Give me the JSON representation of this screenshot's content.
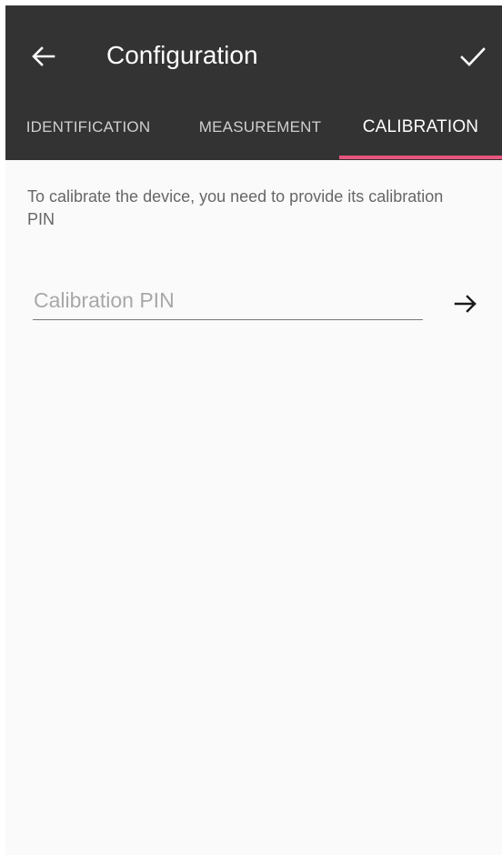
{
  "header": {
    "title": "Configuration",
    "back_icon": "arrow-left-icon",
    "confirm_icon": "check-icon",
    "background_color": "#333333"
  },
  "tabs": [
    {
      "label": "IDENTIFICATION",
      "selected": false
    },
    {
      "label": "MEASUREMENT",
      "selected": false
    },
    {
      "label": "CALIBRATION",
      "selected": true
    }
  ],
  "tab_indicator_color": "#e8557e",
  "calibration": {
    "description": "To calibrate the device, you need to provide its calibration PIN",
    "pin_input": {
      "placeholder": "Calibration PIN",
      "value": ""
    },
    "submit_icon": "arrow-right-icon"
  }
}
